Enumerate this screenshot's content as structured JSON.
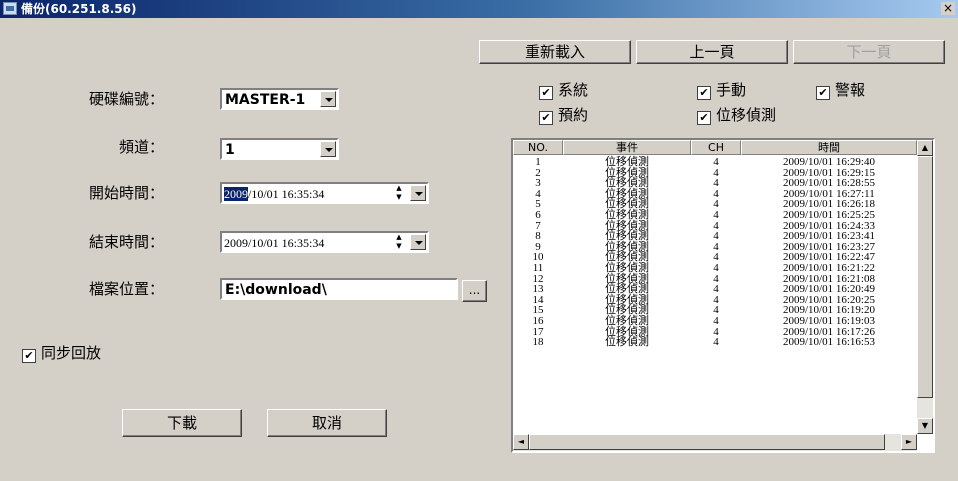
{
  "window": {
    "title": "備份(60.251.8.56)",
    "close": "×"
  },
  "form": {
    "disk_label": "硬碟編號：",
    "disk_value": "MASTER-1",
    "channel_label": "頻道：",
    "channel_value": "1",
    "start_label": "開始時間：",
    "start_value_hl": "2009",
    "start_value_rest": "/10/01 16:35:34",
    "end_label": "結束時間：",
    "end_value": "2009/10/01 16:35:34",
    "path_label": "檔案位置：",
    "path_value": "E:\\download\\",
    "browse": "...",
    "sync_label": "同步回放",
    "download": "下載",
    "cancel": "取消"
  },
  "toolbar": {
    "reload": "重新載入",
    "prev": "上一頁",
    "next": "下一頁"
  },
  "filters": {
    "system": "系統",
    "manual": "手動",
    "alarm": "警報",
    "schedule": "預約",
    "motion": "位移偵測"
  },
  "list": {
    "columns": [
      "NO.",
      "事件",
      "CH",
      "時間"
    ],
    "rows": [
      [
        "1",
        "位移偵測",
        "4",
        "2009/10/01 16:29:40"
      ],
      [
        "2",
        "位移偵測",
        "4",
        "2009/10/01 16:29:15"
      ],
      [
        "3",
        "位移偵測",
        "4",
        "2009/10/01 16:28:55"
      ],
      [
        "4",
        "位移偵測",
        "4",
        "2009/10/01 16:27:11"
      ],
      [
        "5",
        "位移偵測",
        "4",
        "2009/10/01 16:26:18"
      ],
      [
        "6",
        "位移偵測",
        "4",
        "2009/10/01 16:25:25"
      ],
      [
        "7",
        "位移偵測",
        "4",
        "2009/10/01 16:24:33"
      ],
      [
        "8",
        "位移偵測",
        "4",
        "2009/10/01 16:23:41"
      ],
      [
        "9",
        "位移偵測",
        "4",
        "2009/10/01 16:23:27"
      ],
      [
        "10",
        "位移偵測",
        "4",
        "2009/10/01 16:22:47"
      ],
      [
        "11",
        "位移偵測",
        "4",
        "2009/10/01 16:21:22"
      ],
      [
        "12",
        "位移偵測",
        "4",
        "2009/10/01 16:21:08"
      ],
      [
        "13",
        "位移偵測",
        "4",
        "2009/10/01 16:20:49"
      ],
      [
        "14",
        "位移偵測",
        "4",
        "2009/10/01 16:20:25"
      ],
      [
        "15",
        "位移偵測",
        "4",
        "2009/10/01 16:19:20"
      ],
      [
        "16",
        "位移偵測",
        "4",
        "2009/10/01 16:19:03"
      ],
      [
        "17",
        "位移偵測",
        "4",
        "2009/10/01 16:17:26"
      ],
      [
        "18",
        "位移偵測",
        "4",
        "2009/10/01 16:16:53"
      ]
    ]
  },
  "icons": {
    "check": "✔",
    "up": "▲",
    "down": "▼",
    "left": "◄",
    "right": "►"
  }
}
